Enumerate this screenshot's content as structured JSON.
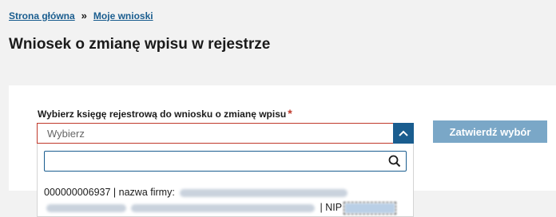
{
  "breadcrumb": {
    "home": "Strona główna",
    "separator": "»",
    "current": "Moje wnioski"
  },
  "page": {
    "title": "Wniosek o zmianę wpisu w rejestrze"
  },
  "form": {
    "label": "Wybierz księgę rejestrową do wniosku o zmianę wpisu",
    "required_mark": "*",
    "select_value": "Wybierz",
    "confirm_label": "Zatwierdź wybór"
  },
  "dropdown": {
    "search_value": "",
    "options": [
      {
        "number": "000000006937",
        "separator": "|",
        "name_label": "nazwa firmy:",
        "nip_separator": "|",
        "nip_label": "NIP"
      }
    ]
  },
  "colors": {
    "link": "#1a5d8f",
    "error_border": "#c0392b",
    "toggle_bg": "#1a5d8f",
    "confirm_disabled": "#7aa7c7"
  }
}
